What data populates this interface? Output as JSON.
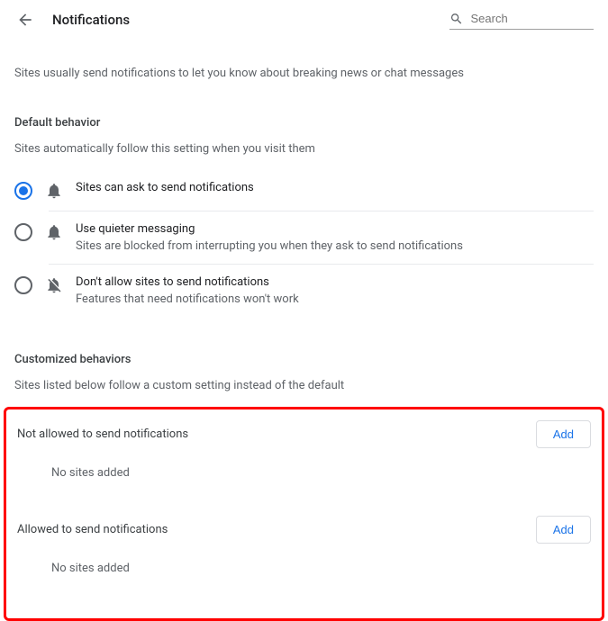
{
  "header": {
    "title": "Notifications",
    "search_placeholder": "Search"
  },
  "intro": "Sites usually send notifications to let you know about breaking news or chat messages",
  "default_behavior": {
    "heading": "Default behavior",
    "subheading": "Sites automatically follow this setting when you visit them",
    "options": [
      {
        "title": "Sites can ask to send notifications",
        "desc": "",
        "selected": true
      },
      {
        "title": "Use quieter messaging",
        "desc": "Sites are blocked from interrupting you when they ask to send notifications",
        "selected": false
      },
      {
        "title": "Don't allow sites to send notifications",
        "desc": "Features that need notifications won't work",
        "selected": false
      }
    ]
  },
  "custom": {
    "heading": "Customized behaviors",
    "subheading": "Sites listed below follow a custom setting instead of the default",
    "not_allowed_title": "Not allowed to send notifications",
    "allowed_title": "Allowed to send notifications",
    "add_label": "Add",
    "empty_label": "No sites added"
  }
}
